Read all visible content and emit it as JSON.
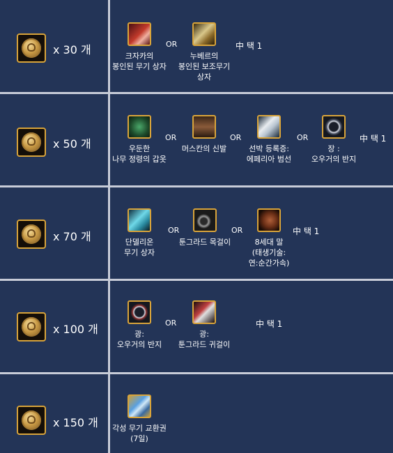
{
  "rows": [
    {
      "quantity": "x 30 개",
      "items": [
        {
          "icon": "red-chest-icon",
          "label_lines": [
            "크자카의",
            "봉인된 무기 상자"
          ]
        },
        {
          "icon": "gold-chest-icon",
          "label_lines": [
            "누베르의",
            "봉인된 보조무기",
            "상자"
          ]
        }
      ],
      "separator": "OR",
      "choice_label": "中 택 1"
    },
    {
      "quantity": "x 50 개",
      "items": [
        {
          "icon": "green-armor-icon",
          "label_lines": [
            "우둔한",
            "나무 정령의 갑옷"
          ]
        },
        {
          "icon": "boots-icon",
          "label_lines": [
            "머스칸의 신발"
          ]
        },
        {
          "icon": "flag-icon",
          "label_lines": [
            "선박 등록증:",
            "에페리아 범선"
          ]
        },
        {
          "icon": "ring-icon",
          "label_lines": [
            "장 :",
            "오우거의 반지"
          ]
        }
      ],
      "separator": "OR",
      "choice_label": "中 택 1"
    },
    {
      "quantity": "x 70 개",
      "items": [
        {
          "icon": "cyan-chest-icon",
          "label_lines": [
            "단델리온",
            "무기 상자"
          ]
        },
        {
          "icon": "necklace-icon",
          "label_lines": [
            "툰그라드 목걸이"
          ]
        },
        {
          "icon": "horse-icon",
          "label_lines": [
            "8세대 말",
            "(태생기술:",
            "연:순간가속)"
          ]
        }
      ],
      "separator": "OR",
      "choice_label": "中 택 1"
    },
    {
      "quantity": "x 100 개",
      "items": [
        {
          "icon": "ring-icon",
          "label_lines": [
            "광:",
            "오우거의 반지"
          ]
        },
        {
          "icon": "earring-icon",
          "label_lines": [
            "광:",
            "툰그라드 귀걸이"
          ]
        }
      ],
      "separator": "OR",
      "choice_label": "中 택 1"
    },
    {
      "quantity": "x 150 개",
      "items": [
        {
          "icon": "ticket-icon",
          "label_lines": [
            "각성 무기 교환권",
            "(7일)"
          ]
        }
      ],
      "separator": "",
      "choice_label": ""
    }
  ]
}
